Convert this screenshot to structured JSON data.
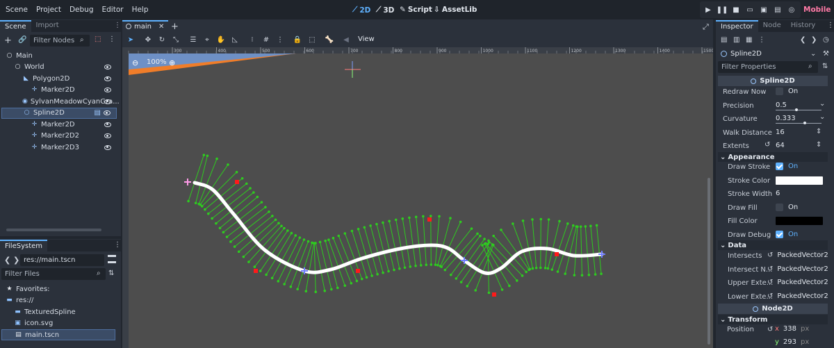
{
  "menu": [
    "Scene",
    "Project",
    "Debug",
    "Editor",
    "Help"
  ],
  "modes": {
    "m2d": "2D",
    "m3d": "3D",
    "script": "Script",
    "assetlib": "AssetLib"
  },
  "renderer": "Mobile",
  "scene_dock": {
    "tabs": [
      "Scene",
      "Import"
    ],
    "filter_placeholder": "Filter Nodes",
    "tree": [
      {
        "label": "Main",
        "depth": 0,
        "icon": "node-icon",
        "eye": false
      },
      {
        "label": "World",
        "depth": 1,
        "icon": "node-icon",
        "eye": true
      },
      {
        "label": "Polygon2D",
        "depth": 2,
        "icon": "polygon-icon",
        "eye": true
      },
      {
        "label": "Marker2D",
        "depth": 3,
        "icon": "marker-icon",
        "eye": true
      },
      {
        "label": "SylvanMeadowCyanGra...",
        "depth": 2,
        "icon": "sprite-icon",
        "eye": true
      },
      {
        "label": "Spline2D",
        "depth": 2,
        "icon": "node-icon",
        "eye": true,
        "selected": true
      },
      {
        "label": "Marker2D",
        "depth": 3,
        "icon": "marker-icon",
        "eye": true
      },
      {
        "label": "Marker2D2",
        "depth": 3,
        "icon": "marker-icon",
        "eye": true
      },
      {
        "label": "Marker2D3",
        "depth": 3,
        "icon": "marker-icon",
        "eye": true
      }
    ]
  },
  "filesystem": {
    "tab": "FileSystem",
    "path": "res://main.tscn",
    "filter_placeholder": "Filter Files",
    "items": [
      {
        "label": "Favorites:",
        "icon": "star-icon"
      },
      {
        "label": "res://",
        "icon": "folder-icon"
      },
      {
        "label": "TexturedSpline",
        "icon": "folder-icon"
      },
      {
        "label": "icon.svg",
        "icon": "image-icon"
      },
      {
        "label": "main.tscn",
        "icon": "scene-icon",
        "selected": true
      }
    ]
  },
  "editor": {
    "scene_tab": "main",
    "view_label": "View",
    "zoom": "100%",
    "ruler_ticks": [
      "300",
      "400",
      "500",
      "600",
      "700",
      "800",
      "900",
      "1000",
      "1100",
      "1200",
      "1300",
      "1400",
      "1500"
    ]
  },
  "inspector": {
    "tabs": [
      "Inspector",
      "Node",
      "History"
    ],
    "node_name": "Spline2D",
    "filter_placeholder": "Filter Properties",
    "class_header": "Spline2D",
    "props": [
      {
        "label": "Redraw Now",
        "type": "check",
        "checked": false,
        "value": "On"
      },
      {
        "label": "Precision",
        "type": "slider",
        "value": "0.5"
      },
      {
        "label": "Curvature",
        "type": "slider",
        "value": "0.333"
      },
      {
        "label": "Walk Distance",
        "type": "spin",
        "value": "16"
      },
      {
        "label": "Extents",
        "type": "spin",
        "value": "64",
        "revert": true
      }
    ],
    "appearance_header": "Appearance",
    "appearance": [
      {
        "label": "Draw Stroke",
        "type": "check",
        "checked": true,
        "value": "On"
      },
      {
        "label": "Stroke Color",
        "type": "color",
        "color": "#ffffff"
      },
      {
        "label": "Stroke Width",
        "type": "text",
        "value": "6"
      },
      {
        "label": "Draw Fill",
        "type": "check",
        "checked": false,
        "value": "On"
      },
      {
        "label": "Fill Color",
        "type": "color",
        "color": "#000000"
      },
      {
        "label": "Draw Debug",
        "type": "check",
        "checked": true,
        "value": "On"
      }
    ],
    "data_header": "Data",
    "data": [
      {
        "label": "Intersects",
        "value": "PackedVector2"
      },
      {
        "label": "Intersect N...",
        "value": "PackedVector2"
      },
      {
        "label": "Upper Exte...",
        "value": "PackedVector2"
      },
      {
        "label": "Lower Exte...",
        "value": "PackedVector2"
      }
    ],
    "node2d_header": "Node2D",
    "transform_header": "Transform",
    "position_label": "Position",
    "position": {
      "x_label": "x",
      "x": "338",
      "y_label": "y",
      "y": "293",
      "unit": "px"
    }
  },
  "colors": {
    "accent": "#5fb2ff",
    "viewport_bg": "#4d4d4d",
    "debug_green": "#2ecc1f",
    "marker_red": "#ff1a1a"
  }
}
